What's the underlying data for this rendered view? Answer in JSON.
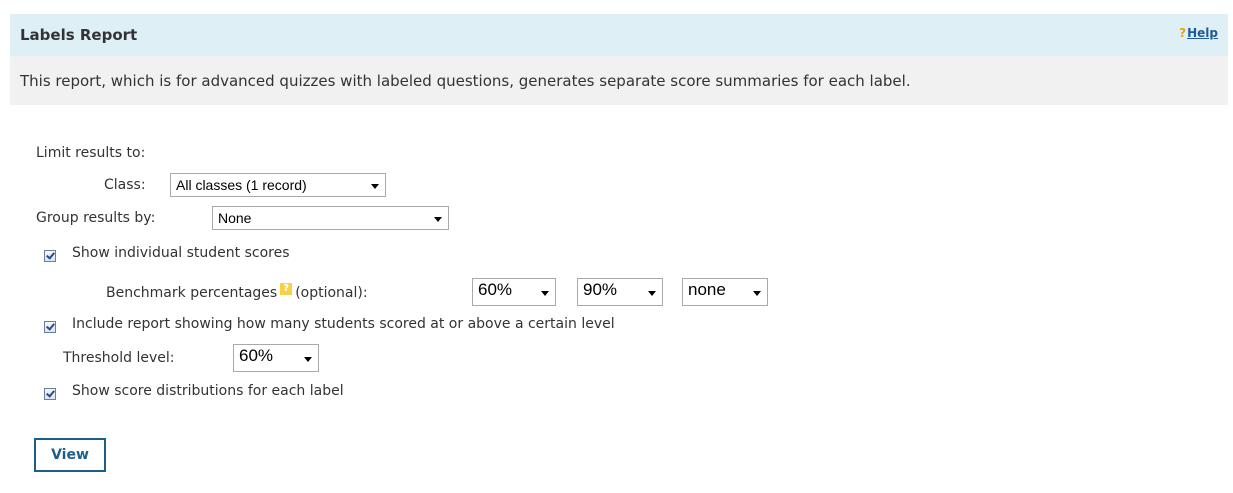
{
  "header": {
    "title": "Labels Report",
    "help_icon": "?",
    "help_label": "Help"
  },
  "description": "This report, which is for advanced quizzes with labeled questions, generates separate score summaries for each label.",
  "form": {
    "limit_label": "Limit results to:",
    "class_label": "Class:",
    "class_value": "All classes (1 record)",
    "group_label": "Group results by:",
    "group_value": "None",
    "show_individual": {
      "label": "Show individual student scores",
      "checked": true
    },
    "benchmark_label": "Benchmark percentages",
    "benchmark_optional": "(optional):",
    "benchmark_values": [
      "60%",
      "90%",
      "none"
    ],
    "include_threshold": {
      "label": "Include report showing how many students scored at or above a certain level",
      "checked": true
    },
    "threshold_label": "Threshold level:",
    "threshold_value": "60%",
    "show_distributions": {
      "label": "Show score distributions for each label",
      "checked": true
    },
    "view_button": "View"
  },
  "colors": {
    "header_bg": "#deeff6",
    "description_bg": "#f1f1f1",
    "link": "#1d5a9e",
    "button_border": "#1b5f8a"
  }
}
